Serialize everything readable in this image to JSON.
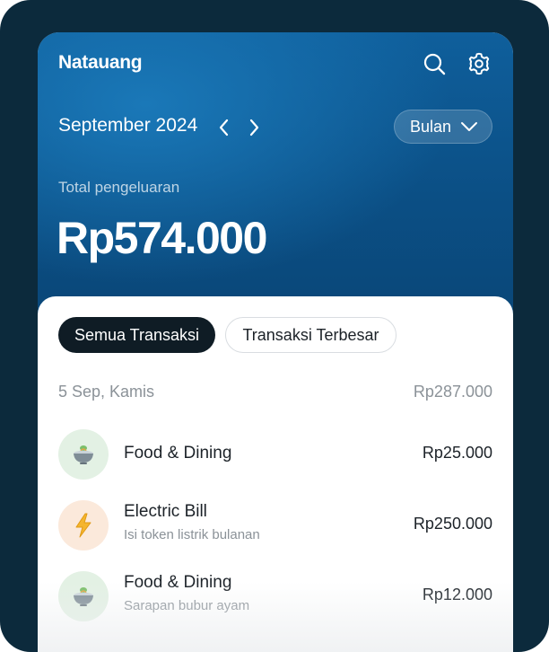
{
  "app": {
    "title": "Natauang"
  },
  "header": {
    "period": "September 2024",
    "range_selector": "Bulan",
    "total_label": "Total pengeluaran",
    "total_amount": "Rp574.000"
  },
  "tabs": [
    {
      "label": "Semua Transaksi",
      "active": true
    },
    {
      "label": "Transaksi Terbesar",
      "active": false
    }
  ],
  "groups": [
    {
      "date": "5 Sep, Kamis",
      "total": "Rp287.000",
      "transactions": [
        {
          "title": "Food & Dining",
          "note": "",
          "amount": "Rp25.000",
          "icon": "noodle-bowl-icon"
        },
        {
          "title": "Electric Bill",
          "note": "Isi token listrik bulanan",
          "amount": "Rp250.000",
          "icon": "lightning-icon"
        },
        {
          "title": "Food & Dining",
          "note": "Sarapan bubur ayam",
          "amount": "Rp12.000",
          "icon": "noodle-bowl-icon"
        }
      ]
    }
  ],
  "colors": {
    "header_blue": "#0b4f85",
    "active_tab": "#0f1c25",
    "frame": "#0c2a3c",
    "food_badge": "#e3f1e4",
    "bill_badge": "#fbe9db"
  }
}
